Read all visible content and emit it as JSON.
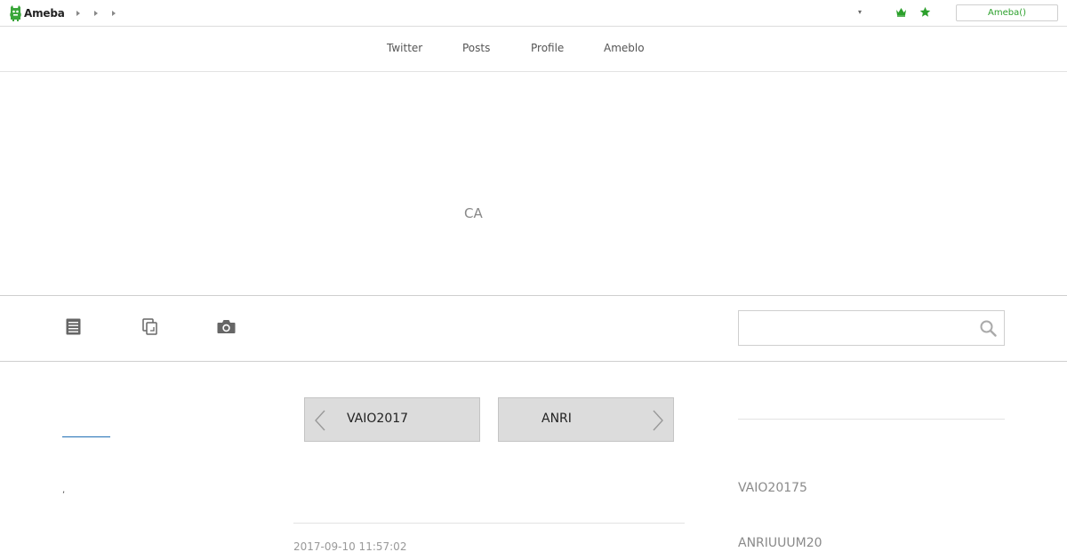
{
  "topbar": {
    "logo_text": "Ameba",
    "account_button_label": "Ameba()",
    "dropdown_caret": "▾",
    "accent_color": "#2ca02c"
  },
  "nav": {
    "items": [
      {
        "label": "Twitter"
      },
      {
        "label": "Posts"
      },
      {
        "label": "Profile"
      },
      {
        "label": "Ameblo"
      }
    ]
  },
  "header": {
    "title": "CA"
  },
  "toolbar": {
    "icons": [
      "article-icon",
      "copy-icon",
      "camera-icon"
    ],
    "search": {
      "placeholder": "",
      "value": ""
    }
  },
  "left": {
    "dot_text": ","
  },
  "pager": {
    "prev_label": "VAIO2017",
    "next_label": "ANRI"
  },
  "post": {
    "date": "2017-09-10 11:57:02"
  },
  "sidebar": {
    "entries": [
      {
        "label": "VAIO20175"
      },
      {
        "label": "ANRIUUUM20"
      }
    ]
  }
}
